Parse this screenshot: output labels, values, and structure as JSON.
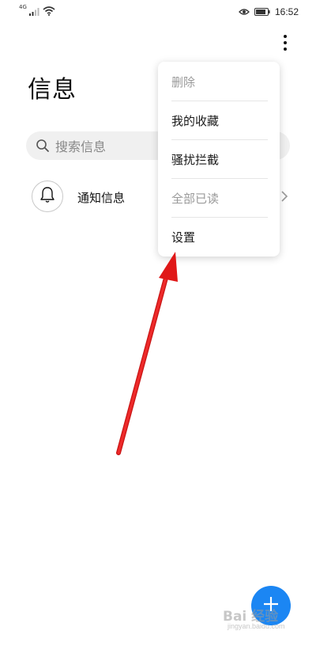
{
  "status_bar": {
    "network": "4G",
    "time": "16:52"
  },
  "page": {
    "title": "信息"
  },
  "search": {
    "placeholder": "搜索信息"
  },
  "list": {
    "items": [
      {
        "label": "通知信息",
        "icon": "bell-icon"
      }
    ]
  },
  "menu": {
    "items": [
      {
        "label": "删除",
        "enabled": false
      },
      {
        "label": "我的收藏",
        "enabled": true
      },
      {
        "label": "骚扰拦截",
        "enabled": true
      },
      {
        "label": "全部已读",
        "enabled": false
      },
      {
        "label": "设置",
        "enabled": true
      }
    ]
  },
  "fab": {
    "icon": "plus-icon"
  },
  "colors": {
    "accent": "#1b86f3",
    "annotation_arrow": "#e01818"
  },
  "watermark": {
    "text": "Bai 经验",
    "sub": "jingyan.baidu.com"
  }
}
